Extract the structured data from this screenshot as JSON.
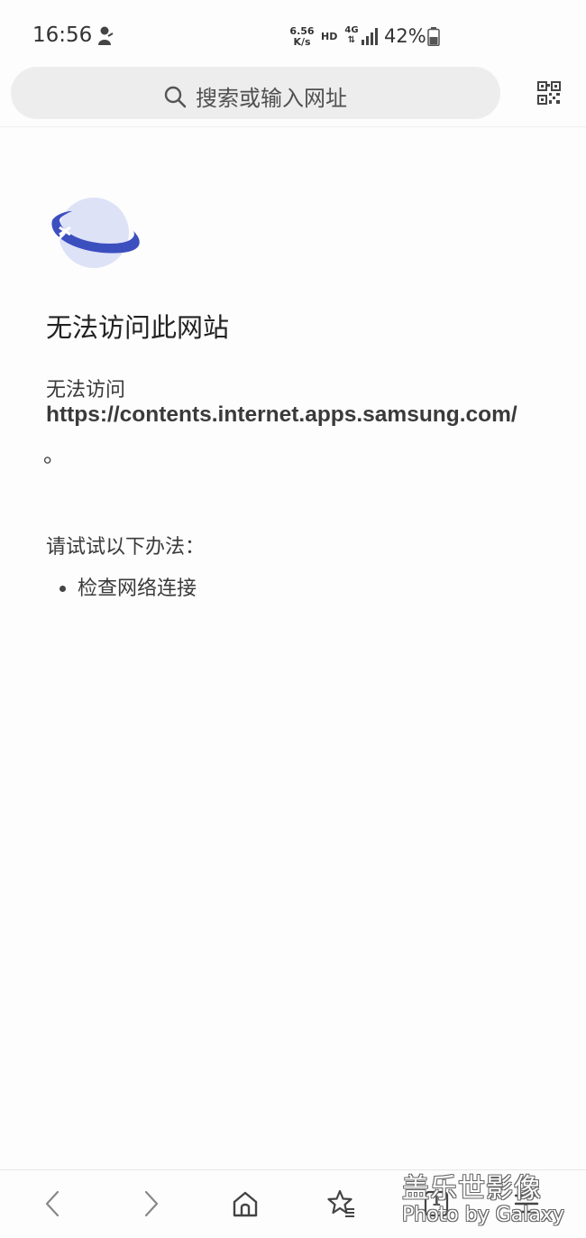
{
  "status_bar": {
    "time": "16:56",
    "net_speed_value": "6.56",
    "net_speed_unit": "K/s",
    "hd_label": "HD",
    "network_label": "4G",
    "battery_percent": "42%",
    "notification_icon": "notification-icon",
    "signal_icon": "signal-icon",
    "battery_icon": "battery-icon"
  },
  "address_bar": {
    "placeholder": "搜索或输入网址",
    "search_icon": "search-icon",
    "qr_icon": "qr-code-icon"
  },
  "error_page": {
    "icon": "broken-planet-icon",
    "title": "无法访问此网站",
    "intro": "无法访问",
    "url": "https://contents.internet.apps.samsung.com/",
    "period": "。",
    "suggestions_heading": "请试试以下办法：",
    "suggestions": [
      "检查网络连接"
    ]
  },
  "bottom_nav": {
    "back_icon": "back-icon",
    "forward_icon": "forward-icon",
    "home_icon": "home-icon",
    "bookmarks_icon": "bookmarks-icon",
    "tabs_icon": "tabs-icon",
    "tabs_count": "1",
    "menu_icon": "menu-icon"
  },
  "watermark": {
    "line1": "盖乐世影像",
    "line2": "Photo by Galaxy"
  },
  "colors": {
    "accent_blue": "#3c4fbf",
    "planet_light": "#dde2f7",
    "address_bar_bg": "#ededed",
    "page_bg": "#fdfdfd"
  }
}
